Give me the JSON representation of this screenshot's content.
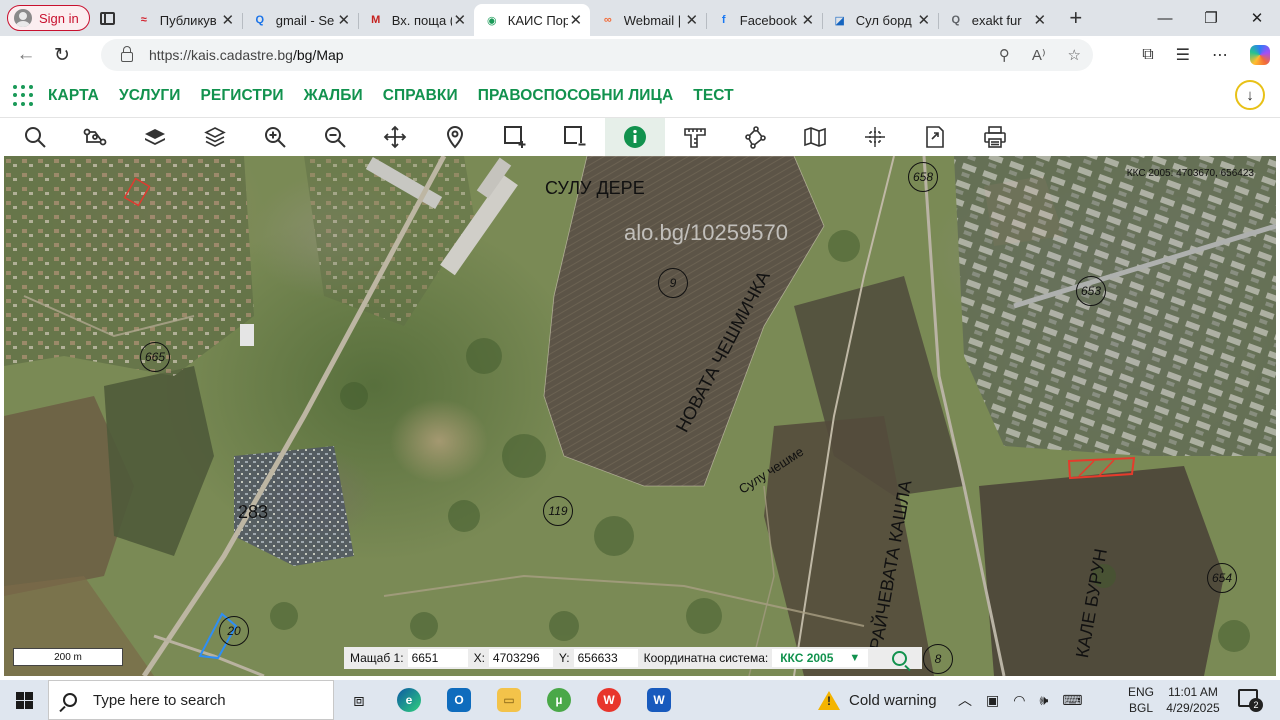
{
  "browser": {
    "signin_label": "Sign in",
    "tabs": [
      {
        "title": "Публикув",
        "fav_color": "#d3212c",
        "fav_glyph": "≈"
      },
      {
        "title": "gmail - Se",
        "fav_color": "#1a73e8",
        "fav_glyph": "Q"
      },
      {
        "title": "Вх. поща (",
        "fav_color": "#c5221f",
        "fav_glyph": "M"
      },
      {
        "title": "КАИС Пор",
        "fav_color": "#1a9a58",
        "fav_glyph": "◉"
      },
      {
        "title": "Webmail |",
        "fav_color": "#f26b38",
        "fav_glyph": "∞"
      },
      {
        "title": "Facebook",
        "fav_color": "#1877f2",
        "fav_glyph": "f"
      },
      {
        "title": "Сул борд",
        "fav_color": "#1565c0",
        "fav_glyph": "◪"
      },
      {
        "title": "exakt fur",
        "fav_color": "#5f6368",
        "fav_glyph": "Q"
      }
    ],
    "url_host": "https://kais.cadastre.bg",
    "url_path": "/bg/Map"
  },
  "site": {
    "menu": [
      "КАРТА",
      "УСЛУГИ",
      "РЕГИСТРИ",
      "ЖАЛБИ",
      "СПРАВКИ",
      "ПРАВОСПОСОБНИ ЛИЦА",
      "ТЕСТ"
    ]
  },
  "toolbar": {
    "tools": [
      "search-tool",
      "route-tool",
      "layers-tool",
      "layer-stack-tool",
      "zoom-in-tool",
      "zoom-out-tool",
      "pan-tool",
      "location-tool",
      "add-area-tool",
      "remove-area-tool",
      "info-tool",
      "measure-tool",
      "polygon-tool",
      "map-tool",
      "grid-tool",
      "export-tool",
      "print-tool"
    ],
    "active_tool": "info-tool",
    "accent": "#12924e"
  },
  "map": {
    "labels": {
      "sulu_dere": "СУЛУ ДЕРЕ",
      "novata_cheshmichka": "НОВАТА ЧЕШМИЧКА",
      "sulu_cheshme": "Сулу чешме",
      "raychevata_kashla": "РАЙЧЕВАТА КАШЛА",
      "kale_burun": "КАЛЕ БУРУН",
      "plot_283": "283"
    },
    "watermark": "alo.bg/10259570",
    "corner_coords": "ККС 2005: 4703670, 656423",
    "circles": [
      "658",
      "9",
      "653",
      "665",
      "119",
      "20",
      "654",
      "8"
    ],
    "scale": "200 m"
  },
  "coordbar": {
    "scale_label": "Мащаб 1:",
    "scale_value": "6651",
    "x_label": "X:",
    "x_value": "4703296",
    "y_label": "Y:",
    "y_value": "656633",
    "system_label": "Координатна система:",
    "system_value": "ККС 2005"
  },
  "taskbar": {
    "search_placeholder": "Type here to search",
    "weather": "Cold warning",
    "lang_top": "ENG",
    "lang_bottom": "BGL",
    "time": "11:01 AM",
    "date": "4/29/2025",
    "notifications": "2"
  }
}
